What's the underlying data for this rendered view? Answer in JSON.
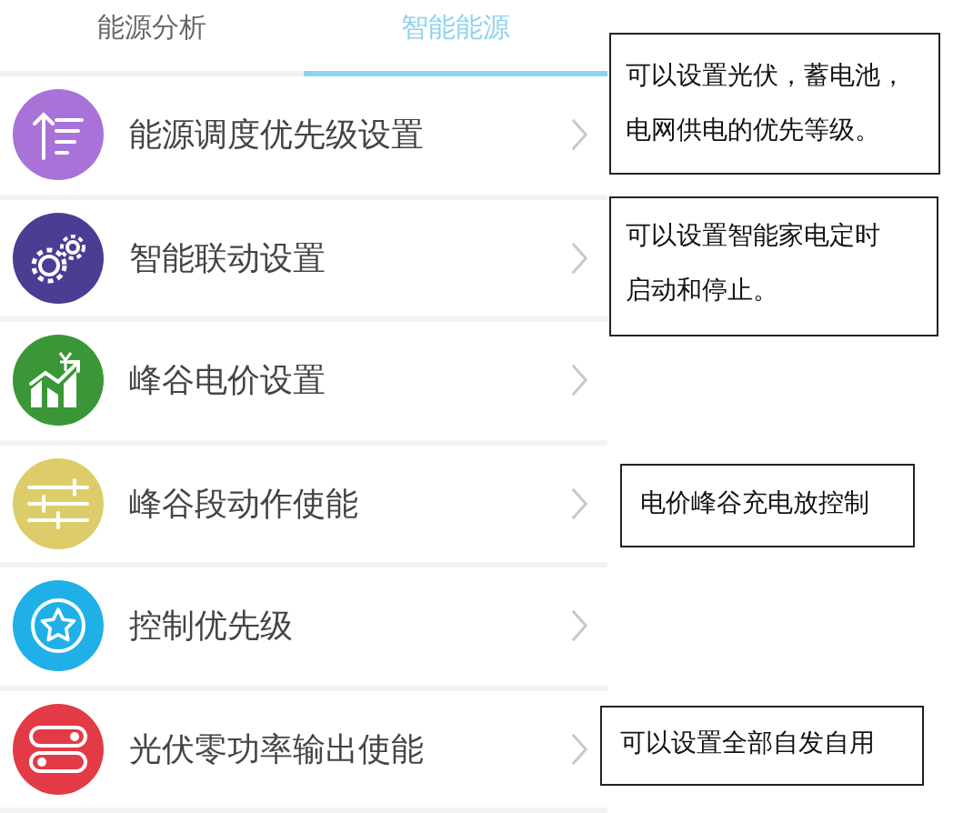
{
  "tabs": [
    {
      "label": "能源分析",
      "selected": false
    },
    {
      "label": "智能能源",
      "selected": true
    }
  ],
  "items": [
    {
      "label": "能源调度优先级设置",
      "kind": "priority",
      "color": "#a872d8",
      "note": "可以设置光伏，蓄电池，电网供电的优先等级。"
    },
    {
      "label": "智能联动设置",
      "kind": "gears",
      "color": "#4a3d94",
      "note": "可以设置智能家电定时启动和停止。"
    },
    {
      "label": "峰谷电价设置",
      "kind": "price",
      "color": "#3a9636"
    },
    {
      "label": "峰谷段动作使能",
      "kind": "sliders",
      "color": "#dccd6a",
      "note": "电价峰谷充电放控制"
    },
    {
      "label": "控制优先级",
      "kind": "star",
      "color": "#1fb0e8"
    },
    {
      "label": "光伏零功率输出使能",
      "kind": "toggles",
      "color": "#e23b46",
      "note": "可以设置全部自发自用"
    }
  ]
}
